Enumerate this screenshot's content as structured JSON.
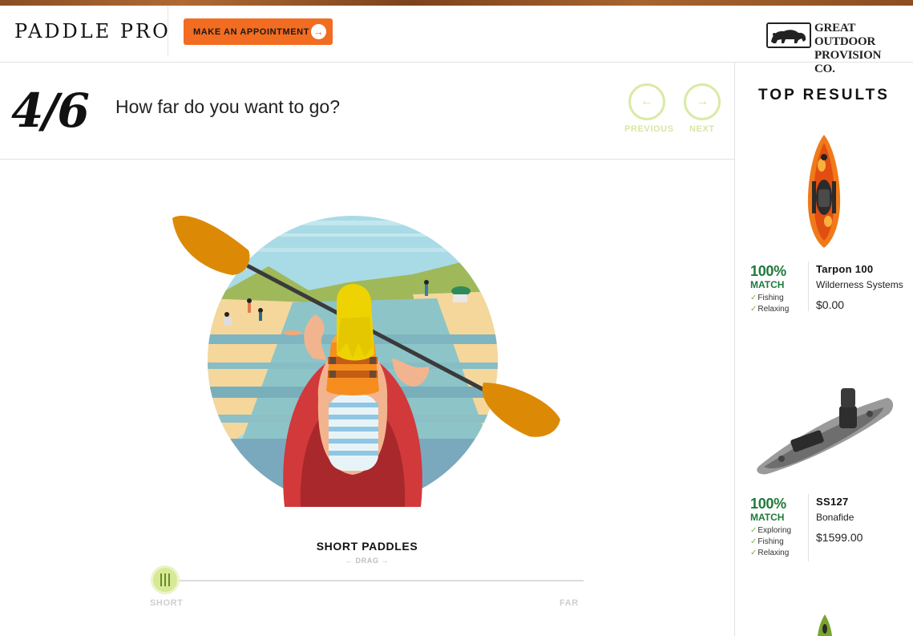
{
  "header": {
    "logo_text": "PADDLE PRO",
    "appointment_button": "MAKE AN APPOINTMENT",
    "brand_name_line1": "GREAT OUTDOOR",
    "brand_name_line2": "PROVISION CO."
  },
  "question": {
    "step": "4/6",
    "text": "How far do you want to go?",
    "previous_label": "PREVIOUS",
    "next_label": "NEXT"
  },
  "slider": {
    "value_label": "SHORT PADDLES",
    "drag_hint": "← DRAG →",
    "min_label": "SHORT",
    "max_label": "FAR",
    "position": 0.0
  },
  "sidebar": {
    "title": "TOP RESULTS",
    "results": [
      {
        "match_pct": "100%",
        "match_word": "MATCH",
        "tags": [
          "Fishing",
          "Relaxing"
        ],
        "name": "Tarpon 100",
        "brand": "Wilderness Systems",
        "price": "$0.00"
      },
      {
        "match_pct": "100%",
        "match_word": "MATCH",
        "tags": [
          "Exploring",
          "Fishing",
          "Relaxing"
        ],
        "name": "SS127",
        "brand": "Bonafide",
        "price": "$1599.00"
      }
    ]
  },
  "colors": {
    "accent_orange": "#f26c21",
    "match_green": "#1f7a3c",
    "nav_disabled_green": "#d9eaa5",
    "slider_handle": "#d6ea96"
  },
  "icons": [
    "arrow-right-icon",
    "arrow-left-icon",
    "grip-icon",
    "check-icon",
    "bison-logo-icon"
  ]
}
